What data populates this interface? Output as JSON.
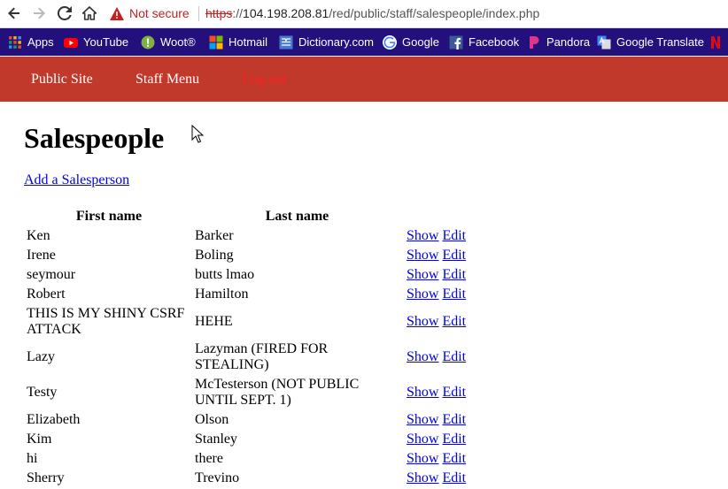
{
  "browser": {
    "security_label": "Not secure",
    "url_scheme": "https",
    "url_sep": "://",
    "url_host": "104.198.208.81",
    "url_path": "/red/public/staff/salespeople/index.php"
  },
  "bookmarks": [
    {
      "label": "Apps",
      "icon": "apps-grid-icon"
    },
    {
      "label": "YouTube",
      "icon": "youtube-icon"
    },
    {
      "label": "Woot®",
      "icon": "woot-icon"
    },
    {
      "label": "Hotmail",
      "icon": "hotmail-icon"
    },
    {
      "label": "Dictionary.com",
      "icon": "dictionary-icon"
    },
    {
      "label": "Google",
      "icon": "google-icon"
    },
    {
      "label": "Facebook",
      "icon": "facebook-icon"
    },
    {
      "label": "Pandora",
      "icon": "pandora-icon"
    },
    {
      "label": "Google Translate",
      "icon": "google-translate-icon"
    }
  ],
  "staff_nav": {
    "public_site": "Public Site",
    "staff_menu": "Staff Menu",
    "log_out": "Log out"
  },
  "page": {
    "title": "Salespeople",
    "add_link": "Add a Salesperson"
  },
  "table": {
    "headers": [
      "First name",
      "Last name"
    ],
    "show_label": "Show",
    "edit_label": "Edit",
    "rows": [
      {
        "first": "Ken",
        "last": "Barker"
      },
      {
        "first": "Irene",
        "last": "Boling"
      },
      {
        "first": "seymour",
        "last": "butts lmao"
      },
      {
        "first": "Robert",
        "last": "Hamilton"
      },
      {
        "first": "THIS IS MY SHINY CSRF ATTACK",
        "last": "HEHE"
      },
      {
        "first": "Lazy",
        "last": "Lazyman (FIRED FOR STEALING)"
      },
      {
        "first": "Testy",
        "last": "McTesterson (NOT PUBLIC UNTIL SEPT. 1)"
      },
      {
        "first": "Elizabeth",
        "last": "Olson"
      },
      {
        "first": "Kim",
        "last": "Stanley"
      },
      {
        "first": "hi",
        "last": "there"
      },
      {
        "first": "Sherry",
        "last": "Trevino"
      }
    ]
  },
  "colors": {
    "bookmarks_bg": "#23107c",
    "staff_nav_bg": "#c0392b",
    "logout": "#ff2020",
    "link": "#0000ee",
    "not_secure": "#c5221f"
  }
}
